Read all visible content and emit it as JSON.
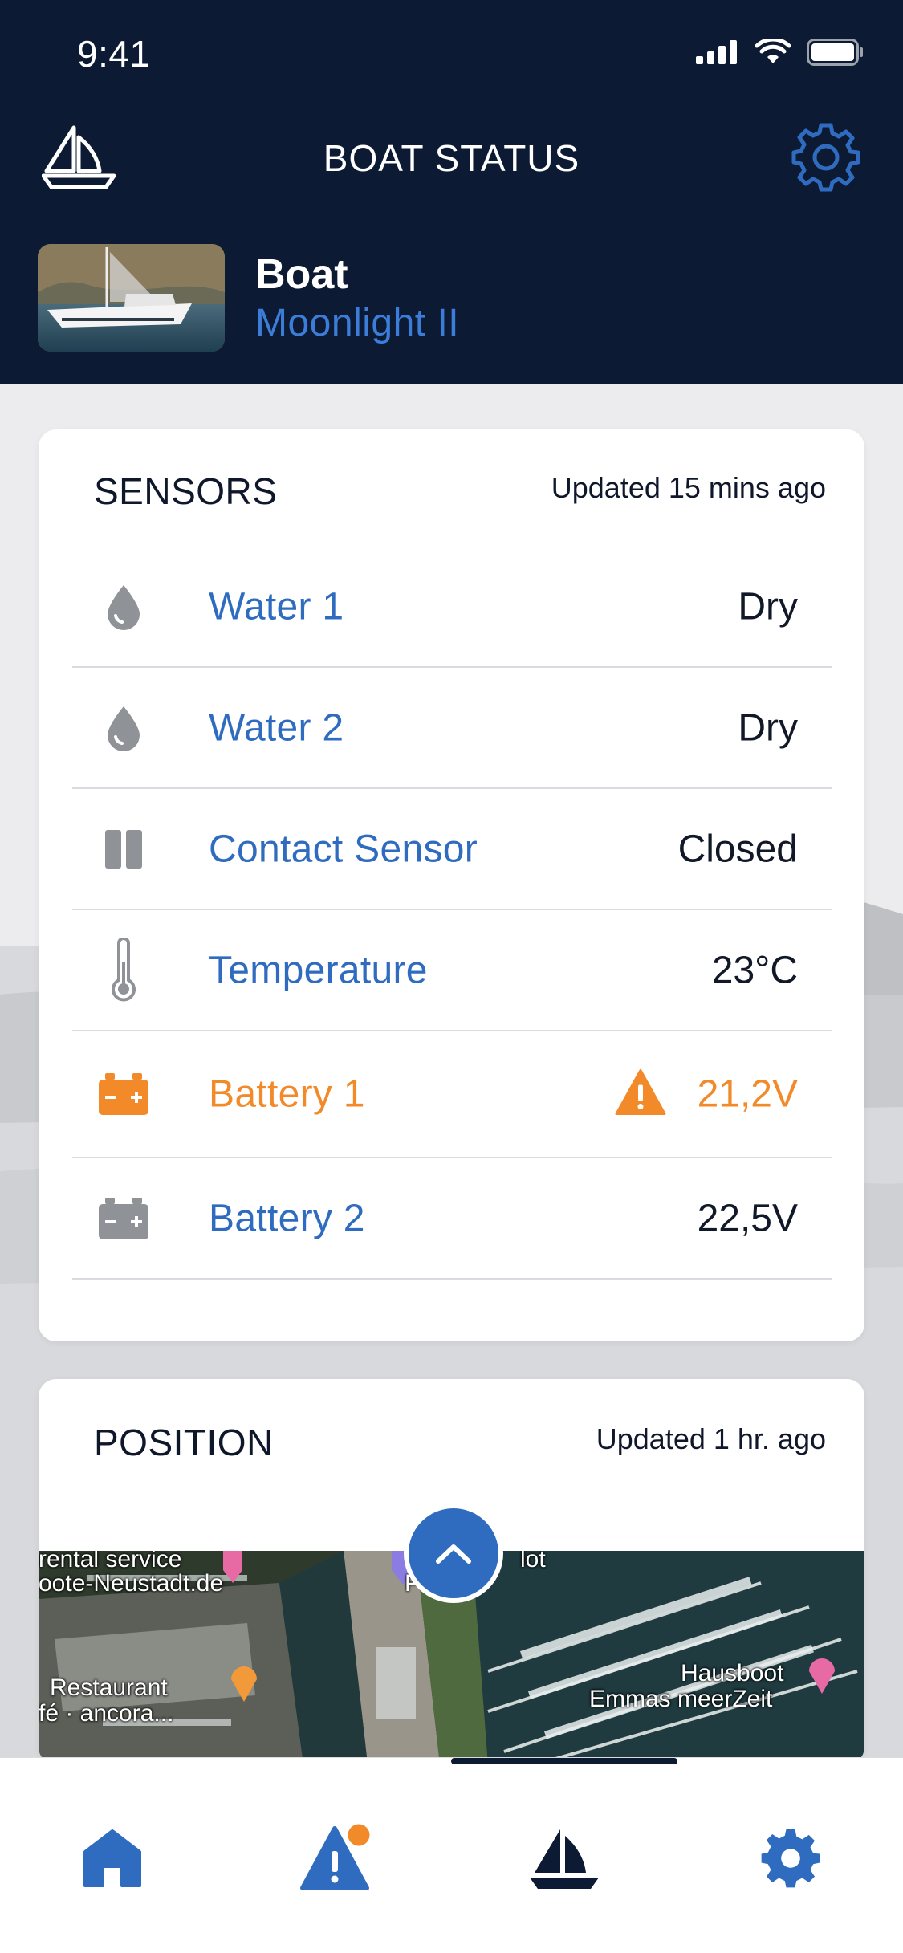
{
  "status_bar": {
    "time": "9:41"
  },
  "header": {
    "title": "BOAT STATUS",
    "boat_label": "Boat",
    "boat_name": "Moonlight II"
  },
  "sensors": {
    "title": "SENSORS",
    "updated": "Updated 15 mins ago",
    "rows": [
      {
        "label": "Water 1",
        "value": "Dry",
        "icon": "water-drop-icon",
        "warning": false
      },
      {
        "label": "Water 2",
        "value": "Dry",
        "icon": "water-drop-icon",
        "warning": false
      },
      {
        "label": "Contact Sensor",
        "value": "Closed",
        "icon": "contact-sensor-icon",
        "warning": false
      },
      {
        "label": "Temperature",
        "value": "23°C",
        "icon": "thermometer-icon",
        "warning": false
      },
      {
        "label": "Battery 1",
        "value": "21,2V",
        "icon": "battery-icon",
        "warning": true
      },
      {
        "label": "Battery 2",
        "value": "22,5V",
        "icon": "battery-icon",
        "warning": false
      }
    ]
  },
  "position": {
    "title": "POSITION",
    "updated": "Updated 1 hr. ago",
    "map_labels": {
      "rental_1": "rental service",
      "rental_2": "oote-Neustadt.de",
      "restaurant_1": "Restaurant",
      "restaurant_2": "fé · ancora...",
      "hausboot_1": "Hausboot",
      "hausboot_2": "Emmas meerZeit",
      "lot_1": "lot",
      "lot_2": "Po     tz"
    }
  },
  "tabbar": {
    "items": [
      "home-icon",
      "alerts-icon",
      "boat-icon",
      "settings-icon"
    ]
  },
  "colors": {
    "header_bg": "#0c1a33",
    "accent_blue": "#2f6cc0",
    "warning_orange": "#f28a2a"
  }
}
